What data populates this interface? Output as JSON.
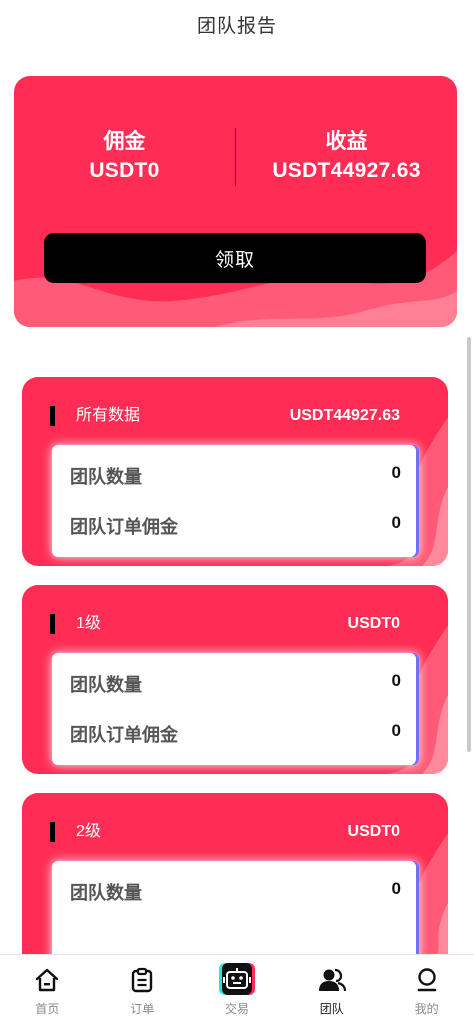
{
  "header": {
    "title": "团队报告"
  },
  "summary": {
    "commission_label": "佣金",
    "commission_value": "USDT0",
    "earnings_label": "收益",
    "earnings_value": "USDT44927.63",
    "claim_label": "领取"
  },
  "levels": [
    {
      "name": "所有数据",
      "total": "USDT44927.63",
      "stats": [
        {
          "label": "团队数量",
          "value": "0"
        },
        {
          "label": "团队订单佣金",
          "value": "0"
        }
      ]
    },
    {
      "name": "1级",
      "total": "USDT0",
      "stats": [
        {
          "label": "团队数量",
          "value": "0"
        },
        {
          "label": "团队订单佣金",
          "value": "0"
        }
      ]
    },
    {
      "name": "2级",
      "total": "USDT0",
      "stats": [
        {
          "label": "团队数量",
          "value": "0"
        }
      ]
    }
  ],
  "nav": {
    "items": [
      {
        "label": "首页",
        "icon": "home-icon"
      },
      {
        "label": "订单",
        "icon": "clipboard-icon"
      },
      {
        "label": "交易",
        "icon": "robot-icon"
      },
      {
        "label": "团队",
        "icon": "team-icon",
        "active": true
      },
      {
        "label": "我的",
        "icon": "user-icon"
      }
    ]
  },
  "colors": {
    "accent": "#ff2d55",
    "accent_light": "#ff7088",
    "button": "#000000"
  }
}
